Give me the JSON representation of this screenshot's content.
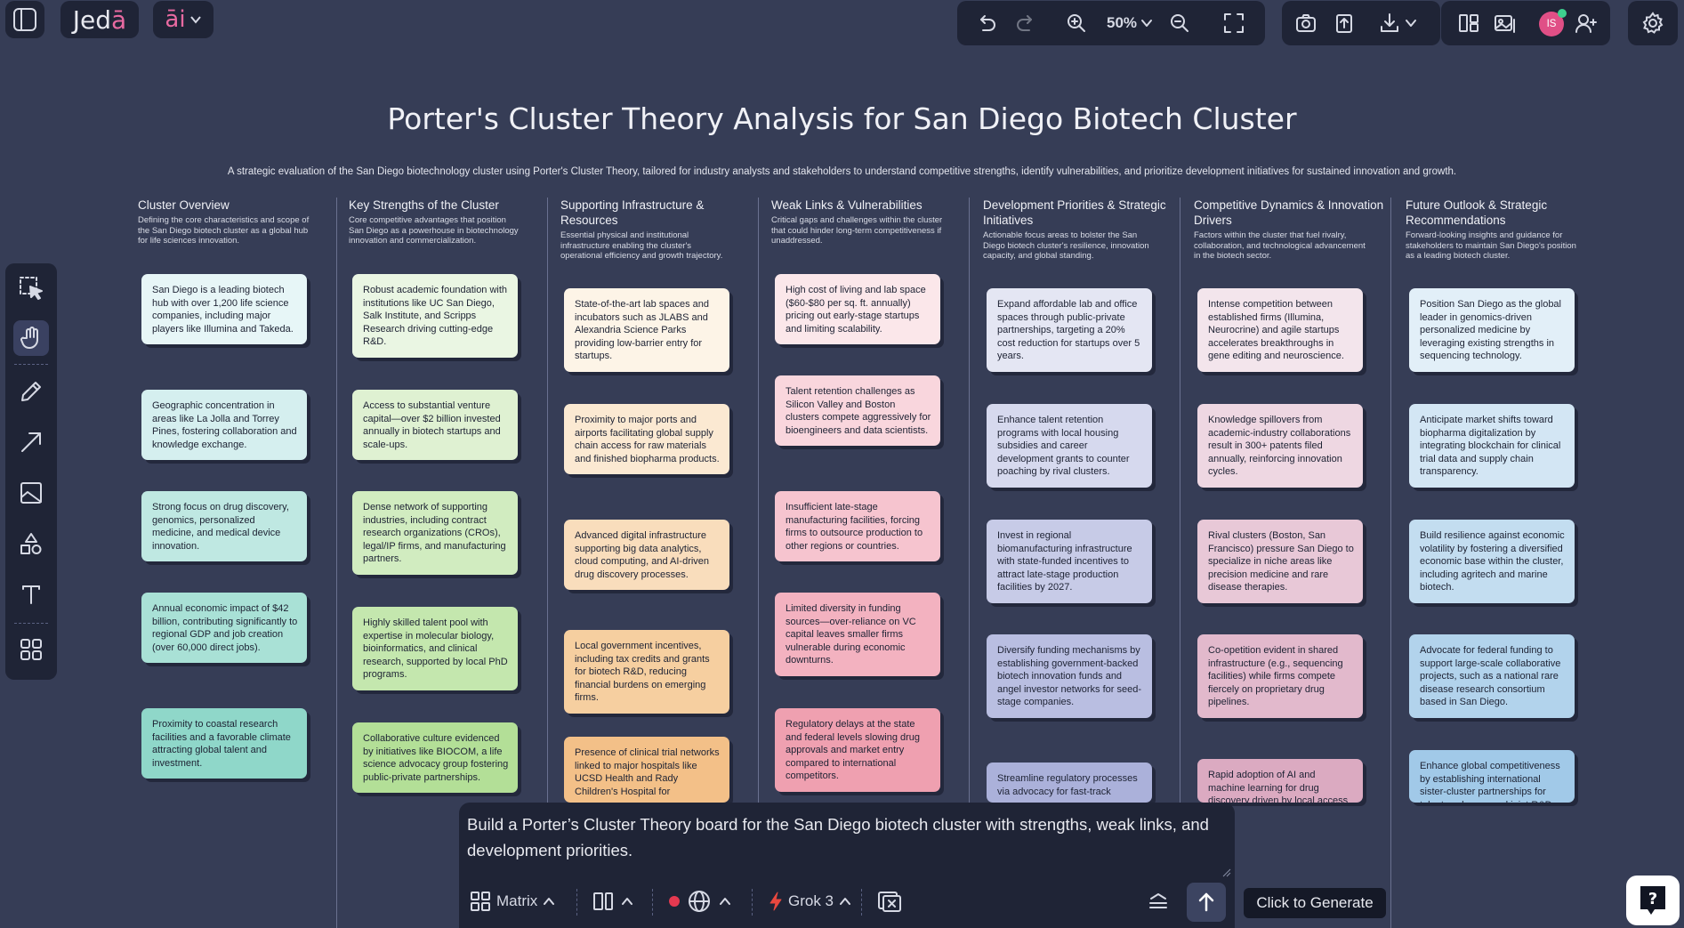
{
  "app": {
    "brand": "Jedā",
    "ai_label": "āi"
  },
  "toolbar": {
    "zoom_level": "50%"
  },
  "board": {
    "title": "Porter's Cluster Theory Analysis for San Diego Biotech Cluster",
    "subtitle": "A strategic evaluation of the San Diego biotechnology cluster using Porter's Cluster Theory, tailored for industry analysts and stakeholders to understand competitive strengths, identify vulnerabilities, and prioritize development initiatives for sustained innovation and growth."
  },
  "columns": [
    {
      "title": "Cluster Overview",
      "desc": "Defining the core characteristics and scope of the San Diego biotech cluster as a global hub for life sciences innovation.",
      "cards": [
        "San Diego is a leading biotech hub with over 1,200 life science companies, including major players like Illumina and Takeda.",
        "Geographic concentration in areas like La Jolla and Torrey Pines, fostering collaboration and knowledge exchange.",
        "Strong focus on drug discovery, genomics, personalized medicine, and medical device innovation.",
        "Annual economic impact of $42 billion, contributing significantly to regional GDP and job creation (over 60,000 direct jobs).",
        "Proximity to coastal research facilities and a favorable climate attracting global talent and investment."
      ]
    },
    {
      "title": "Key Strengths of the Cluster",
      "desc": "Core competitive advantages that position San Diego as a powerhouse in biotechnology innovation and commercialization.",
      "cards": [
        "Robust academic foundation with institutions like UC San Diego, Salk Institute, and Scripps Research driving cutting-edge R&D.",
        "Access to substantial venture capital—over $2 billion invested annually in biotech startups and scale-ups.",
        "Dense network of supporting industries, including contract research organizations (CROs), legal/IP firms, and manufacturing partners.",
        "Highly skilled talent pool with expertise in molecular biology, bioinformatics, and clinical research, supported by local PhD programs.",
        "Collaborative culture evidenced by initiatives like BIOCOM, a life science advocacy group fostering public-private partnerships."
      ]
    },
    {
      "title": "Supporting Infrastructure & Resources",
      "desc": "Essential physical and institutional infrastructure enabling the cluster's operational efficiency and growth trajectory.",
      "cards": [
        "State-of-the-art lab spaces and incubators such as JLABS and Alexandria Science Parks providing low-barrier entry for startups.",
        "Proximity to major ports and airports facilitating global supply chain access for raw materials and finished biopharma products.",
        "Advanced digital infrastructure supporting big data analytics, cloud computing, and AI-driven drug discovery processes.",
        "Local government incentives, including tax credits and grants for biotech R&D, reducing financial burdens on emerging firms.",
        "Presence of clinical trial networks linked to major hospitals like UCSD Health and Rady Children's Hospital for"
      ]
    },
    {
      "title": "Weak Links & Vulnerabilities",
      "desc": "Critical gaps and challenges within the cluster that could hinder long-term competitiveness if unaddressed.",
      "cards": [
        "High cost of living and lab space ($60-$80 per sq. ft. annually) pricing out early-stage startups and limiting scalability.",
        "Talent retention challenges as Silicon Valley and Boston clusters compete aggressively for bioengineers and data scientists.",
        "Insufficient late-stage manufacturing facilities, forcing firms to outsource production to other regions or countries.",
        "Limited diversity in funding sources—over-reliance on VC capital leaves smaller firms vulnerable during economic downturns.",
        "Regulatory delays at the state and federal levels slowing drug approvals and market entry compared to international competitors."
      ]
    },
    {
      "title": "Development Priorities & Strategic Initiatives",
      "desc": "Actionable focus areas to bolster the San Diego biotech cluster's resilience, innovation capacity, and global standing.",
      "cards": [
        "Expand affordable lab and office spaces through public-private partnerships, targeting a 20% cost reduction for startups over 5 years.",
        "Enhance talent retention programs with local housing subsidies and career development grants to counter poaching by rival clusters.",
        "Invest in regional biomanufacturing infrastructure with state-funded incentives to attract late-stage production facilities by 2027.",
        "Diversify funding mechanisms by establishing government-backed biotech innovation funds and angel investor networks for seed-stage companies.",
        "Streamline regulatory processes via advocacy for fast-track"
      ]
    },
    {
      "title": "Competitive Dynamics & Innovation Drivers",
      "desc": "Factors within the cluster that fuel rivalry, collaboration, and technological advancement in the biotech sector.",
      "cards": [
        "Intense competition between established firms (Illumina, Neurocrine) and agile startups accelerates breakthroughs in gene editing and neuroscience.",
        "Knowledge spillovers from academic-industry collaborations result in 300+ patents filed annually, reinforcing innovation cycles.",
        "Rival clusters (Boston, San Francisco) pressure San Diego to specialize in niche areas like precision medicine and rare disease therapies.",
        "Co-opetition evident in shared infrastructure (e.g., sequencing facilities) while firms compete fiercely on proprietary drug pipelines.",
        "Rapid adoption of AI and machine learning for drug discovery driven by local access to talent and cross-industry partnerships, with adoption."
      ]
    },
    {
      "title": "Future Outlook & Strategic Recommendations",
      "desc": "Forward-looking insights and guidance for stakeholders to maintain San Diego's position as a leading biotech cluster.",
      "cards": [
        "Position San Diego as the global leader in genomics-driven personalized medicine by leveraging existing strengths in sequencing technology.",
        "Anticipate market shifts toward biopharma digitalization by integrating blockchain for clinical trial data and supply chain transparency.",
        "Build resilience against economic volatility by fostering a diversified economic base within the cluster, including agritech and marine biotech.",
        "Advocate for federal funding to support large-scale collaborative projects, such as a national rare disease research consortium based in San Diego.",
        "Enhance global competitiveness by establishing international sister-cluster partnerships for talent exchange and joint R&D initiatives."
      ]
    }
  ],
  "prompt": {
    "text": "Build a Porter’s Cluster Theory board for the San Diego biotech cluster with strengths, weak links, and development priorities."
  },
  "bottom_bar": {
    "layout_label": "Matrix",
    "model_label": "Grok 3",
    "generate_tooltip": "Click to Generate"
  },
  "user": {
    "initials": "IS"
  }
}
